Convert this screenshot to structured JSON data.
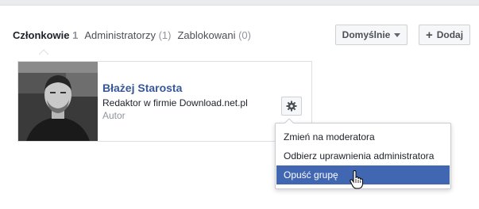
{
  "tabs": [
    {
      "label": "Członkowie",
      "count": "1"
    },
    {
      "label": "Administratorzy",
      "count": "(1)"
    },
    {
      "label": "Zablokowani",
      "count": "(0)"
    }
  ],
  "toolbar": {
    "default_label": "Domyślnie",
    "add_label": "Dodaj"
  },
  "member": {
    "name": "Błażej Starosta",
    "job": "Redaktor w firmie Download.net.pl",
    "role": "Autor"
  },
  "menu": {
    "items": [
      "Zmień na moderatora",
      "Odbierz uprawnienia administratora",
      "Opuść grupę"
    ],
    "highlighted_index": 2
  },
  "colors": {
    "link": "#365899",
    "menu_highlight": "#4267b2",
    "muted": "#90949c"
  }
}
